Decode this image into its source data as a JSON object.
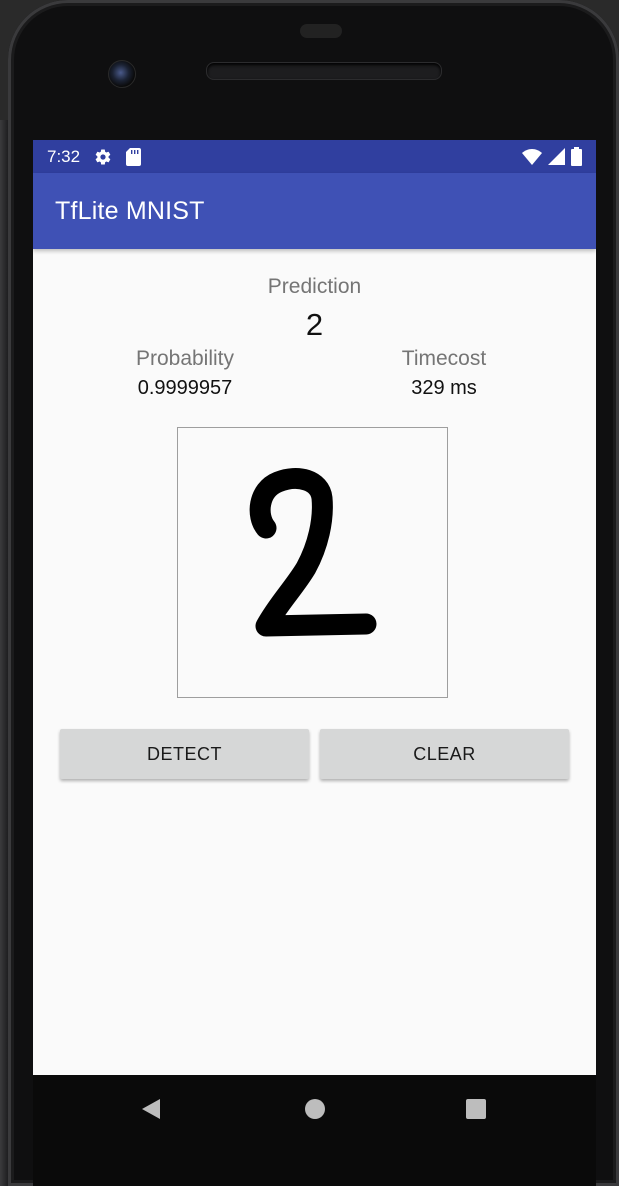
{
  "status_bar": {
    "time": "7:32",
    "icons_left": [
      "gear-icon",
      "sd-card-icon"
    ],
    "icons_right": [
      "wifi-icon",
      "signal-icon",
      "battery-icon"
    ]
  },
  "app_bar": {
    "title": "TfLite MNIST"
  },
  "prediction": {
    "label": "Prediction",
    "value": "2"
  },
  "probability": {
    "label": "Probability",
    "value": "0.9999957"
  },
  "timecost": {
    "label": "Timecost",
    "value": "329 ms"
  },
  "canvas": {
    "drawn_digit_icon": "handwritten-two"
  },
  "buttons": {
    "detect": "DETECT",
    "clear": "CLEAR"
  },
  "nav": {
    "icons": [
      "back-icon",
      "home-icon",
      "recents-icon"
    ]
  },
  "colors": {
    "status_bar": "#303f9f",
    "app_bar": "#3f51b5",
    "button": "#d6d7d7",
    "screen_bg": "#fafafa"
  }
}
